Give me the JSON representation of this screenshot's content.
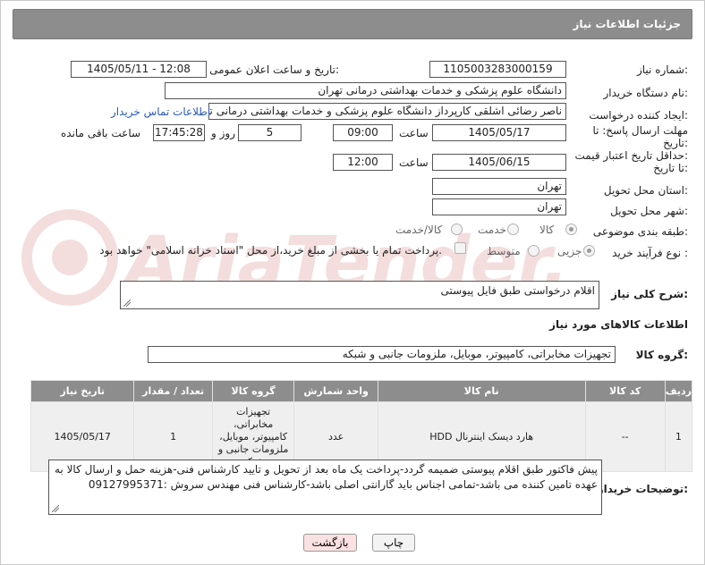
{
  "header": {
    "title": "جزئیات اطلاعات نیاز"
  },
  "form": {
    "need_number_label": "شماره نیاز:",
    "need_number": "1105003283000159",
    "announce_label": "تاریخ و ساعت اعلان عمومی:",
    "announce_value": "1405/05/11 - 12:08",
    "buyer_org_label": "نام دستگاه خریدار:",
    "buyer_org": "دانشگاه علوم پزشکی و خدمات بهداشتی درمانی تهران",
    "requester_label": "ایجاد کننده درخواست:",
    "requester": "ناصر رضائی اشلقی کارپرداز دانشگاه علوم پزشکی و خدمات بهداشتی درمانی تهران",
    "contact_link": "اطلاعات تماس خریدار",
    "deadline_label_1": "مهلت ارسال پاسخ: تا",
    "deadline_label_2": "تاریخ:",
    "deadline_date": "1405/05/17",
    "time_label": "ساعت",
    "deadline_time": "09:00",
    "days_value": "5",
    "days_label": "روز و",
    "remaining_time": "17:45:28",
    "remaining_label": "ساعت باقی مانده",
    "validity_label_1": "حداقل تاریخ اعتبار قیمت:",
    "validity_label_2": "تا تاریخ:",
    "validity_date": "1405/06/15",
    "validity_time": "12:00",
    "province_label": "استان محل تحویل:",
    "province": "تهران",
    "city_label": "شهر محل تحویل:",
    "city": "تهران",
    "category_label": "طبقه بندی موضوعی:",
    "category_options": [
      "کالا",
      "خدمت",
      "کالا/خدمت"
    ],
    "category_selected": "کالا",
    "process_label": "نوع فرآیند خرید :",
    "process_options": [
      "جزیی",
      "متوسط"
    ],
    "process_selected": "جزیی",
    "payment_text": "پرداخت تمام یا بخشی از مبلغ خرید،از محل \"اسناد خزانه اسلامی\" خواهد بود."
  },
  "description": {
    "label": "شرح کلی نیاز:",
    "value": "اقلام درخواستی طبق فایل پیوستی"
  },
  "goods": {
    "section_title": "اطلاعات کالاهای مورد نیاز",
    "group_label": "گروه کالا:",
    "group_value": "تجهیزات مخابراتی، کامپیوتر، موبایل، ملزومات جانبی و شبکه",
    "columns": [
      "ردیف",
      "کد کالا",
      "نام کالا",
      "واحد شمارش",
      "گروه کالا",
      "تعداد / مقدار",
      "تاریخ نیاز"
    ],
    "rows": [
      {
        "row": "1",
        "code": "--",
        "name": "هارد دیسک اینترنال HDD",
        "unit": "عدد",
        "group": "تجهیزات مخابراتی، کامپیوتر، موبایل، ملزومات جانبی و شبکه",
        "qty": "1",
        "date": "1405/05/17"
      }
    ]
  },
  "buyer_notes": {
    "label": "توضیحات خریدار:",
    "value": "پیش فاکتور طبق اقلام پیوستی ضمیمه گردد-پرداخت یک ماه بعد از تحویل و تایید کارشناس فنی-هزینه حمل و ارسال کالا به عهده تامین کننده می باشد-تمامی اجناس باید گارانتی اصلی باشد-کارشناس فنی مهندس سروش :09127995371"
  },
  "buttons": {
    "print": "چاپ",
    "back": "بازگشت"
  },
  "watermark": "AriaTender.net",
  "colors": {
    "header_bg": "#8d8d8d",
    "link": "#2a59b8",
    "back_button_bg": "#fbe1e1",
    "print_button_bg": "#f3f3f3"
  }
}
